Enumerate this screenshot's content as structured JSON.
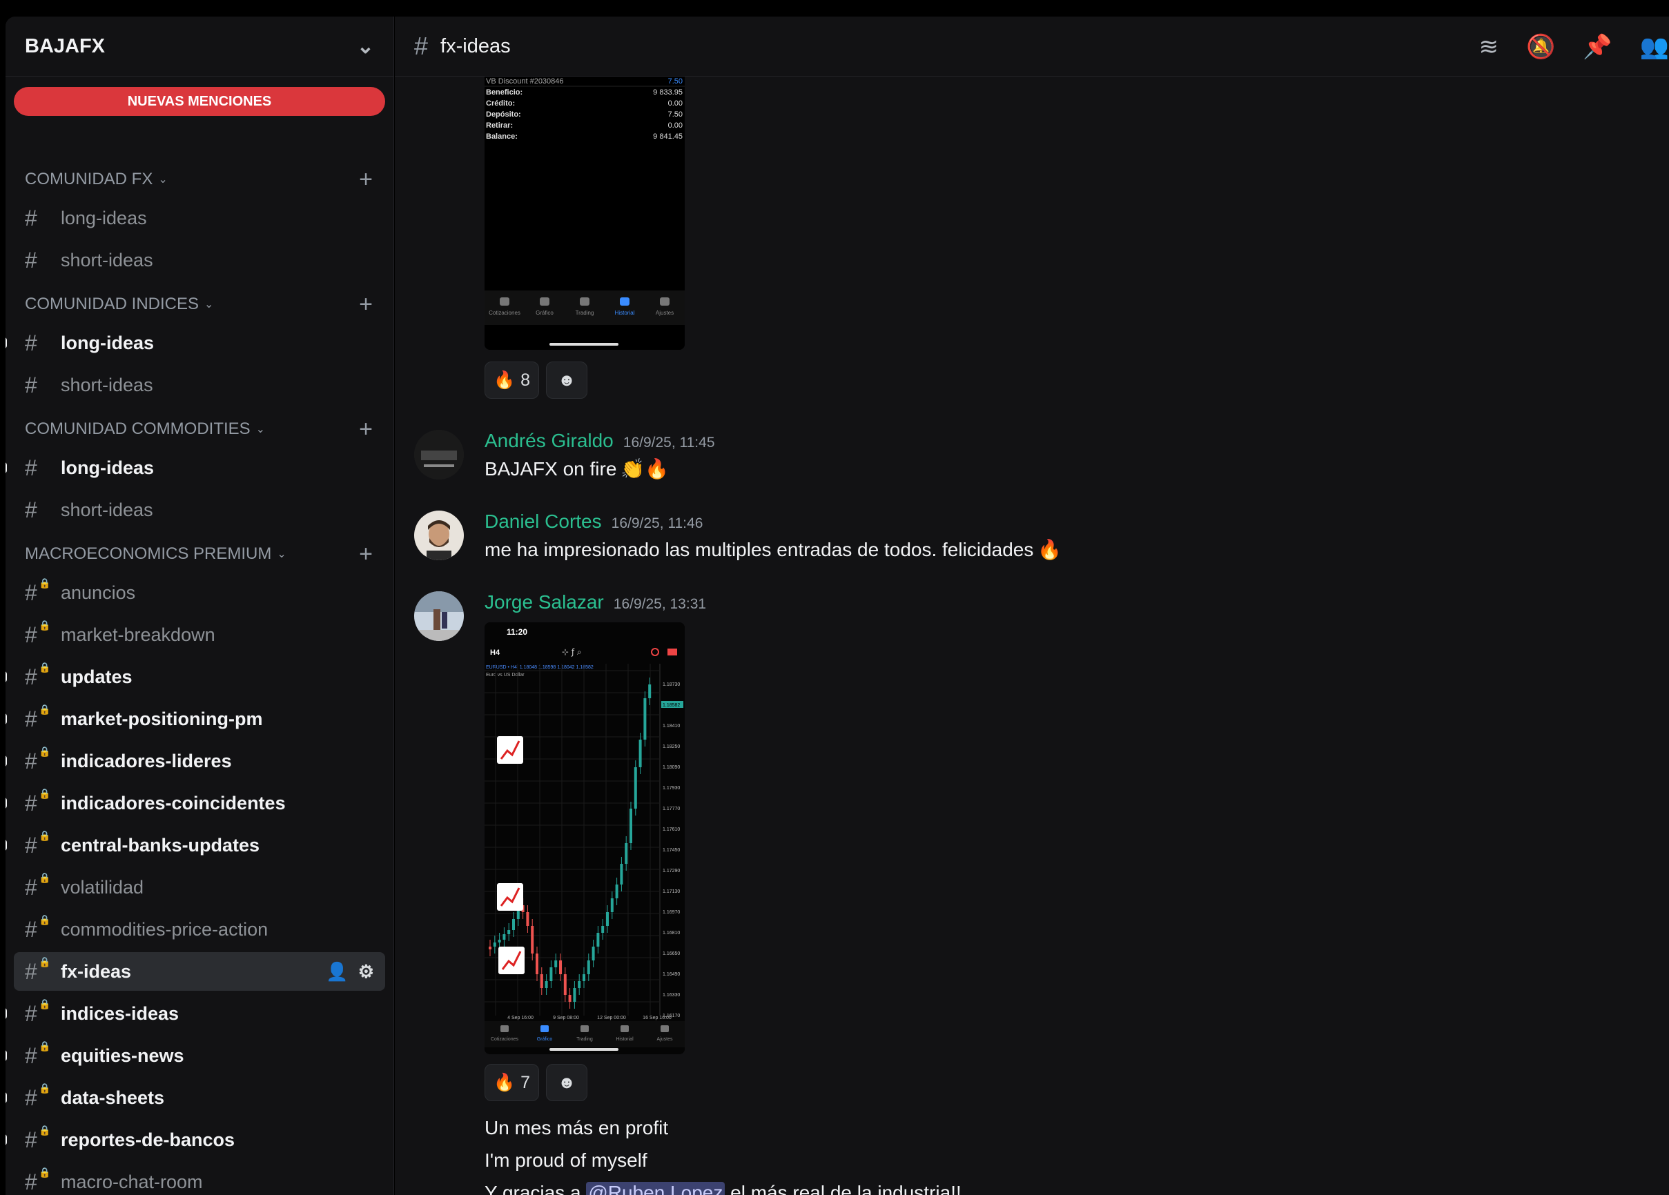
{
  "window": {
    "title_fragment": "BAJAFX"
  },
  "server": {
    "name": "BAJAFX"
  },
  "banner": {
    "new_mentions": "NUEVAS MENCIONES"
  },
  "sidebar": {
    "categories": [
      {
        "name": "COMUNIDAD FX",
        "channels": [
          {
            "name": "long-ideas",
            "unread": false
          },
          {
            "name": "short-ideas",
            "unread": false
          }
        ]
      },
      {
        "name": "COMUNIDAD INDICES",
        "channels": [
          {
            "name": "long-ideas",
            "unread": true
          },
          {
            "name": "short-ideas",
            "unread": false
          }
        ]
      },
      {
        "name": "COMUNIDAD COMMODITIES",
        "channels": [
          {
            "name": "long-ideas",
            "unread": true
          },
          {
            "name": "short-ideas",
            "unread": false
          }
        ]
      },
      {
        "name": "MACROECONOMICS PREMIUM",
        "channels": [
          {
            "name": "anuncios",
            "unread": false
          },
          {
            "name": "market-breakdown",
            "unread": false
          },
          {
            "name": "updates",
            "unread": true
          },
          {
            "name": "market-positioning-pm",
            "unread": true
          },
          {
            "name": "indicadores-lideres",
            "unread": true
          },
          {
            "name": "indicadores-coincidentes",
            "unread": true
          },
          {
            "name": "central-banks-updates",
            "unread": true
          },
          {
            "name": "volatilidad",
            "unread": false
          },
          {
            "name": "commodities-price-action",
            "unread": false
          },
          {
            "name": "fx-ideas",
            "unread": false,
            "active": true
          },
          {
            "name": "indices-ideas",
            "unread": true
          },
          {
            "name": "equities-news",
            "unread": true
          },
          {
            "name": "data-sheets",
            "unread": true
          },
          {
            "name": "reportes-de-bancos",
            "unread": true
          },
          {
            "name": "macro-chat-room",
            "unread": false
          }
        ]
      }
    ]
  },
  "channel": {
    "name": "fx-ideas"
  },
  "first_screenshot": {
    "account_label": "VB Discount #2030846",
    "account_value": "7.50",
    "rows": [
      {
        "label": "Beneficio:",
        "value": "9 833.95"
      },
      {
        "label": "Crédito:",
        "value": "0.00"
      },
      {
        "label": "Depósito:",
        "value": "7.50"
      },
      {
        "label": "Retirar:",
        "value": "0.00"
      },
      {
        "label": "Balance:",
        "value": "9 841.45"
      }
    ],
    "tabs": [
      "Cotizaciones",
      "Gráfico",
      "Trading",
      "Historial",
      "Ajustes"
    ]
  },
  "messages": [
    {
      "reactions": [
        {
          "emoji": "🔥",
          "count": "8"
        }
      ]
    },
    {
      "author": "Andrés Giraldo",
      "timestamp": "16/9/25, 11:45",
      "text": "BAJAFX on fire",
      "emojis": "👏🔥"
    },
    {
      "author": "Daniel Cortes",
      "timestamp": "16/9/25, 11:46",
      "text": "me ha impresionado las multiples entradas de todos. felicidades",
      "emojis": "🔥"
    },
    {
      "author": "Jorge Salazar",
      "timestamp": "16/9/25, 13:31",
      "reactions": [
        {
          "emoji": "🔥",
          "count": "7"
        }
      ],
      "lines": [
        "Un mes más en profit",
        "I'm proud of myself"
      ],
      "line3_before": "Y gracias a",
      "line3_mention": "@Ruben Lopez",
      "line3_after": "el más real de la industria!!"
    }
  ],
  "chart_screenshot": {
    "time": "11:20",
    "timeframe": "H4",
    "symbol_line": "EURUSD • H4, 1.18048 1.18598 1.18042 1.18582",
    "symbol_name": "Euro vs US Dollar",
    "price_labels": [
      "1.18730",
      "1.18582",
      "1.18410",
      "1.18250",
      "1.18090",
      "1.17930",
      "1.17770",
      "1.17610",
      "1.17450",
      "1.17290",
      "1.17130",
      "1.16970",
      "1.16810",
      "1.16650",
      "1.16490",
      "1.16330",
      "1.16170"
    ],
    "date_labels": [
      "4 Sep 16:00",
      "9 Sep 08:00",
      "12 Sep 00:00",
      "16 Sep 16:00"
    ],
    "tabs": [
      "Cotizaciones",
      "Gráfico",
      "Trading",
      "Historial",
      "Ajustes"
    ]
  },
  "colors": {
    "author": "#2bbf90",
    "mention_bg": "#3c4270",
    "banner": "#da373c"
  }
}
